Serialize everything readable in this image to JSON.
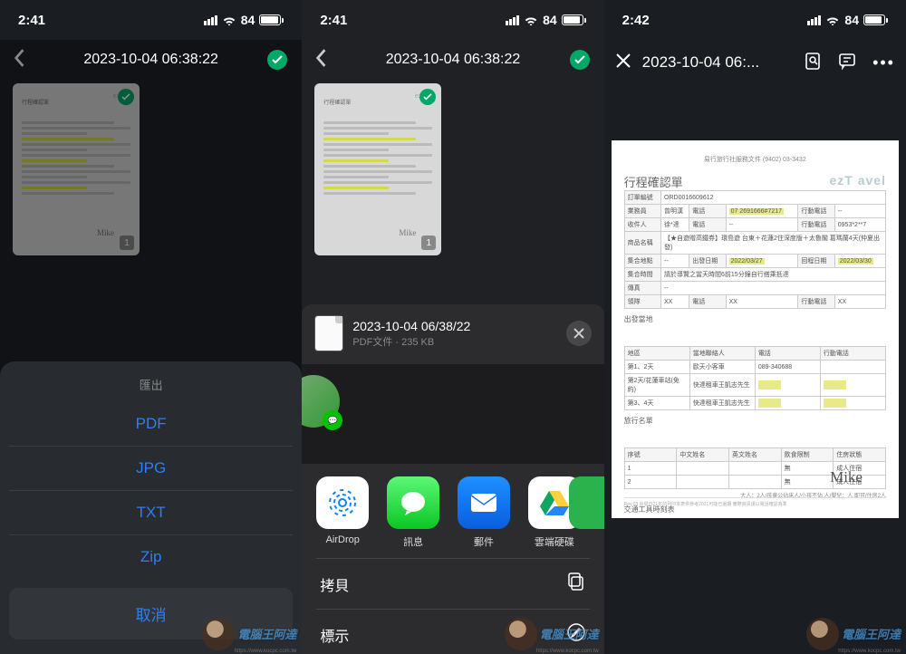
{
  "status": {
    "time1": "2:41",
    "time2": "2:41",
    "time3": "2:42",
    "battery": "84"
  },
  "nav": {
    "title": "2023-10-04 06:38:22",
    "viewer_title": "2023-10-04 06:..."
  },
  "export": {
    "title": "匯出",
    "options": [
      "PDF",
      "JPG",
      "TXT",
      "Zip"
    ],
    "cancel": "取消"
  },
  "share": {
    "filename": "2023-10-04 06/38/22",
    "meta": "PDF文件 · 235 KB",
    "apps": [
      {
        "label": "AirDrop"
      },
      {
        "label": "訊息"
      },
      {
        "label": "郵件"
      },
      {
        "label": "雲端硬碟"
      }
    ],
    "actions": [
      {
        "label": "拷貝"
      },
      {
        "label": "標示"
      }
    ]
  },
  "document": {
    "small_header": "易行旅行社服務文件 (9402) 03-3432",
    "title": "行程確認單",
    "brand": "ezT avel",
    "fields": {
      "order_label": "訂單編號",
      "order_val": "ORD0016609612",
      "contact_label": "業務員",
      "contact_val": "曾明漢",
      "phone_label": "電話",
      "phone_val": "07 2691666#7217",
      "mobile_label": "行動電話",
      "mobile_val": "--",
      "recv_label": "收件人",
      "recv_val": "徐*達",
      "phone2_val": "--",
      "mobile2_val": "0953*2**7",
      "product_label": "商品名稱",
      "product_val": "【★自遊贈高鐵券】環島遊  台東＋花蓮2住深度版＋太魯閣 葛瑪蘭4天(仲夏出發)",
      "meet_label": "集合地點",
      "meet_val": "--",
      "dep_label": "出發日期",
      "dep_val": "2022/03/27",
      "ret_label": "回程日期",
      "ret_val": "2022/03/30",
      "time_label": "集合時間",
      "time_val": "請於導覽之當天時間6前15分鐘自行搭乘抵達",
      "fax_label": "傳真",
      "fax_val": "--",
      "ext_label": "領隊",
      "ext_val": "XX",
      "ext_phone": "XX",
      "ext_mobile": "XX"
    },
    "section2_title": "出發當地",
    "table2_headers": [
      "地區",
      "當地聯絡人",
      "電話",
      "行動電話"
    ],
    "table2_rows": [
      [
        "第1、2天",
        "歐天小客車",
        "089-340688",
        ""
      ],
      [
        "第2天/花蓮車站(免約)",
        "快達租車王凱志先生",
        "",
        ""
      ],
      [
        "第3、4天",
        "快達租車王凱志先生",
        "",
        ""
      ]
    ],
    "section3_title": "旅行名單",
    "table3_headers": [
      "序號",
      "中文姓名",
      "英文姓名",
      "飲食限制",
      "住房狀態"
    ],
    "table3_rows": [
      [
        "1",
        "",
        "",
        "無",
        "成人住宿"
      ],
      [
        "2",
        "",
        "",
        "無",
        "成人住宿"
      ]
    ],
    "summary": "大人：2人/孩童公佔床人/小孩不佔 人/嬰兒：人  即可/住房2人",
    "transport_title": "交通工具時刻表",
    "signature": "Mike",
    "footer_note": "Rev.03 出發日21年前列印本表供參考2021可能已過期 實際資訊請以電話確認為準"
  },
  "watermark": {
    "text": "電腦王阿達",
    "url": "https://www.kocpc.com.tw"
  },
  "thumb": {
    "page": "1"
  }
}
